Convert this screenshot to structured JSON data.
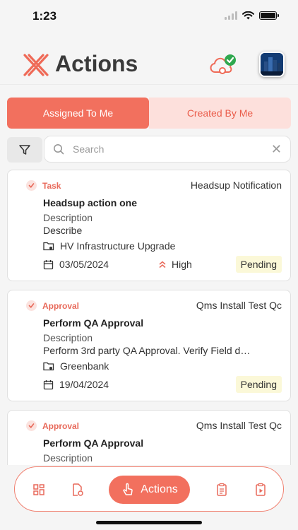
{
  "status_bar": {
    "time": "1:23"
  },
  "header": {
    "title": "Actions"
  },
  "tabs": [
    {
      "label": "Assigned To Me",
      "active": true
    },
    {
      "label": "Created By Me",
      "active": false
    }
  ],
  "search": {
    "placeholder": "Search",
    "value": ""
  },
  "cards": [
    {
      "type": "Task",
      "source": "Headsup Notification",
      "title": "Headsup action one",
      "description_label": "Description",
      "description": "Describe",
      "project": "HV Infrastructure Upgrade",
      "date": "03/05/2024",
      "priority": "High",
      "status": "Pending"
    },
    {
      "type": "Approval",
      "source": "Qms Install Test Qc",
      "title": "Perform QA Approval",
      "description_label": "Description",
      "description": "Perform 3rd party QA Approval. Verify Field d…",
      "project": "Greenbank",
      "date": "19/04/2024",
      "priority": "",
      "status": "Pending"
    },
    {
      "type": "Approval",
      "source": "Qms Install Test Qc",
      "title": "Perform QA Approval",
      "description_label": "Description"
    }
  ],
  "bottom_nav": {
    "items": [
      {
        "icon": "dashboard-icon"
      },
      {
        "icon": "document-settings-icon"
      },
      {
        "icon": "tap-hand-icon",
        "label": "Actions",
        "active": true
      },
      {
        "icon": "clipboard-list-icon"
      },
      {
        "icon": "clipboard-play-icon"
      }
    ]
  },
  "colors": {
    "accent": "#f2705e",
    "accent_light": "#fde0dc",
    "status_pending_bg": "#fbf8d8",
    "sync_ok": "#2fa84f"
  }
}
